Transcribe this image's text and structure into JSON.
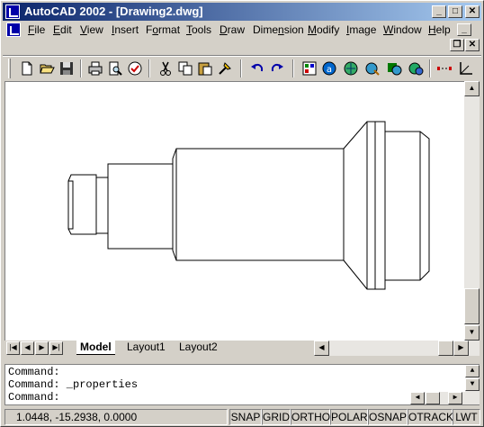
{
  "window": {
    "title": "AutoCAD 2002 - [Drawing2.dwg]"
  },
  "menu": {
    "items": [
      {
        "label": "File",
        "u": "F",
        "rest": "ile"
      },
      {
        "label": "Edit",
        "u": "E",
        "rest": "dit"
      },
      {
        "label": "View",
        "u": "V",
        "rest": "iew"
      },
      {
        "label": "Insert",
        "u": "I",
        "rest": "nsert"
      },
      {
        "label": "Format",
        "pre": "F",
        "u": "o",
        "rest": "rmat"
      },
      {
        "label": "Tools",
        "u": "T",
        "rest": "ools"
      },
      {
        "label": "Draw",
        "u": "D",
        "rest": "raw"
      },
      {
        "label": "Dimension",
        "pre": "Dime",
        "u": "n",
        "rest": "sion"
      },
      {
        "label": "Modify",
        "u": "M",
        "rest": "odify"
      },
      {
        "label": "Image",
        "u": "I",
        "rest": "mage"
      },
      {
        "label": "Window",
        "u": "W",
        "rest": "indow"
      },
      {
        "label": "Help",
        "u": "H",
        "rest": "elp"
      }
    ]
  },
  "toolbar": {
    "icons": [
      "new-icon",
      "open-icon",
      "save-icon",
      "print-icon",
      "print-preview-icon",
      "spell-check-icon",
      "cut-icon",
      "copy-icon",
      "paste-icon",
      "match-properties-icon",
      "undo-icon",
      "redo-icon",
      "properties-icon",
      "design-center-icon",
      "today-icon",
      "hyperlink-icon",
      "web-icon",
      "meet-now-icon",
      "distance-icon",
      "ucs-icon"
    ]
  },
  "tabs": {
    "items": [
      {
        "label": "Model",
        "active": true
      },
      {
        "label": "Layout1",
        "active": false
      },
      {
        "label": "Layout2",
        "active": false
      }
    ]
  },
  "command": {
    "lines": [
      "Command:",
      "Command: _properties",
      "Command:"
    ]
  },
  "status": {
    "coords": "1.0448, -15.2938, 0.0000",
    "toggles": [
      "SNAP",
      "GRID",
      "ORTHO",
      "POLAR",
      "OSNAP",
      "OTRACK",
      "LWT"
    ]
  },
  "colors": {
    "titlebar_start": "#0a246a",
    "titlebar_end": "#a6caf0",
    "face": "#d4d0c8"
  }
}
